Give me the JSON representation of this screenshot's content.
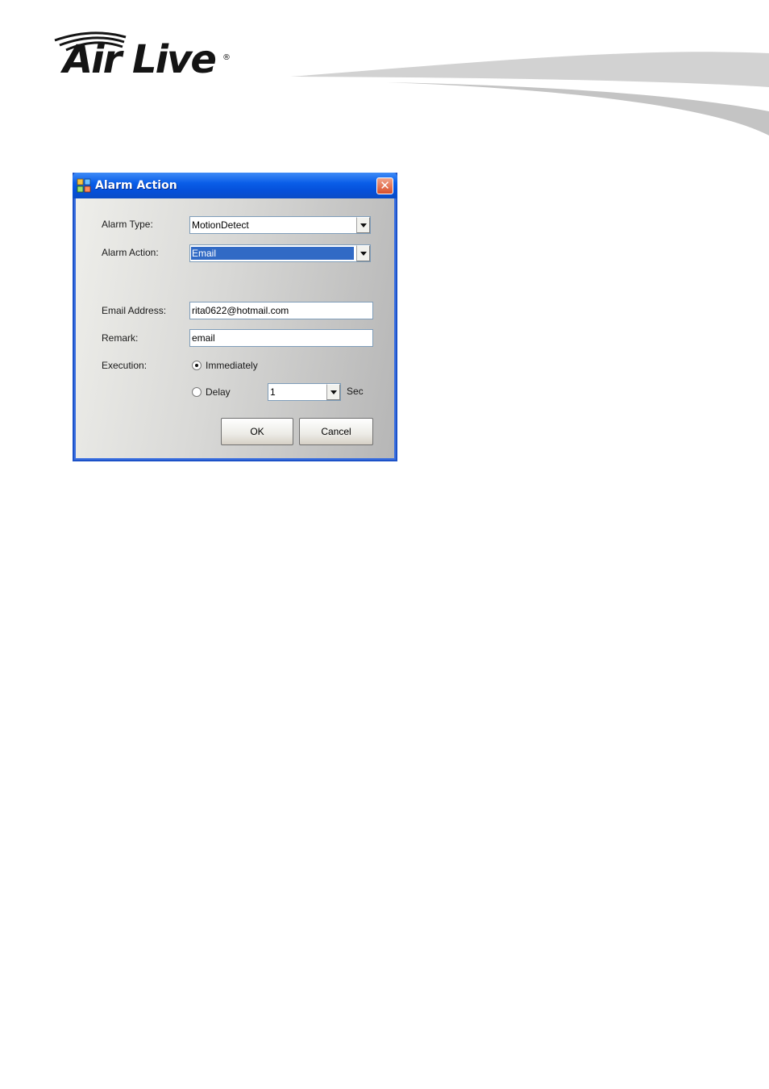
{
  "brand": {
    "logo_text": "Air Live",
    "reg_mark": "®"
  },
  "dialog": {
    "title": "Alarm Action",
    "close_glyph": "✕",
    "labels": {
      "alarm_type": "Alarm Type:",
      "alarm_action": "Alarm Action:",
      "email_address": "Email Address:",
      "remark": "Remark:",
      "execution": "Execution:"
    },
    "alarm_type_value": "MotionDetect",
    "alarm_action_value": "Email",
    "email_address_value": "rita0622@hotmail.com",
    "remark_value": "email",
    "execution": {
      "immediately_label": "Immediately",
      "delay_label": "Delay",
      "delay_value": "1",
      "unit_label": "Sec",
      "selected": "immediately"
    },
    "buttons": {
      "ok": "OK",
      "cancel": "Cancel"
    }
  },
  "icons": {
    "title_icon": "alarm-app-icon",
    "close": "close-icon",
    "dropdown": "chevron-down-icon"
  },
  "colors": {
    "titlebar": "#0a5ee8",
    "selection": "#316ac5",
    "close": "#d8502c"
  }
}
